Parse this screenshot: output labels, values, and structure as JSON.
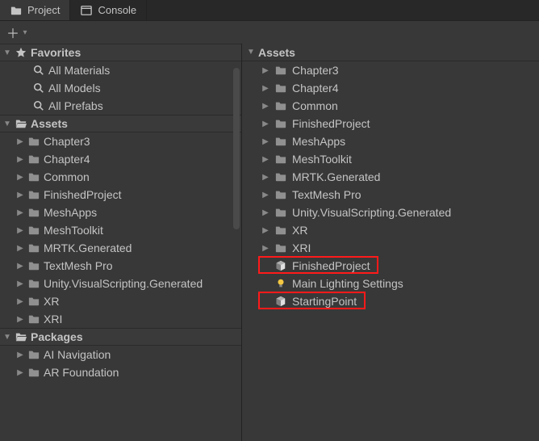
{
  "tabs": {
    "project": "Project",
    "console": "Console"
  },
  "left": {
    "favorites": {
      "label": "Favorites",
      "items": [
        {
          "label": "All Materials"
        },
        {
          "label": "All Models"
        },
        {
          "label": "All Prefabs"
        }
      ]
    },
    "assets": {
      "label": "Assets",
      "items": [
        {
          "label": "Chapter3"
        },
        {
          "label": "Chapter4"
        },
        {
          "label": "Common"
        },
        {
          "label": "FinishedProject"
        },
        {
          "label": "MeshApps"
        },
        {
          "label": "MeshToolkit"
        },
        {
          "label": "MRTK.Generated"
        },
        {
          "label": "TextMesh Pro"
        },
        {
          "label": "Unity.VisualScripting.Generated"
        },
        {
          "label": "XR"
        },
        {
          "label": "XRI"
        }
      ]
    },
    "packages": {
      "label": "Packages",
      "items": [
        {
          "label": "AI Navigation"
        },
        {
          "label": "AR Foundation"
        }
      ]
    }
  },
  "right": {
    "path": "Assets",
    "folders": [
      {
        "label": "Chapter3"
      },
      {
        "label": "Chapter4"
      },
      {
        "label": "Common"
      },
      {
        "label": "FinishedProject"
      },
      {
        "label": "MeshApps"
      },
      {
        "label": "MeshToolkit"
      },
      {
        "label": "MRTK.Generated"
      },
      {
        "label": "TextMesh Pro"
      },
      {
        "label": "Unity.VisualScripting.Generated"
      },
      {
        "label": "XR"
      },
      {
        "label": "XRI"
      }
    ],
    "files": [
      {
        "label": "FinishedProject",
        "type": "scene",
        "highlighted": true
      },
      {
        "label": "Main Lighting Settings",
        "type": "lighting",
        "highlighted": false
      },
      {
        "label": "StartingPoint",
        "type": "scene",
        "highlighted": true
      }
    ]
  }
}
